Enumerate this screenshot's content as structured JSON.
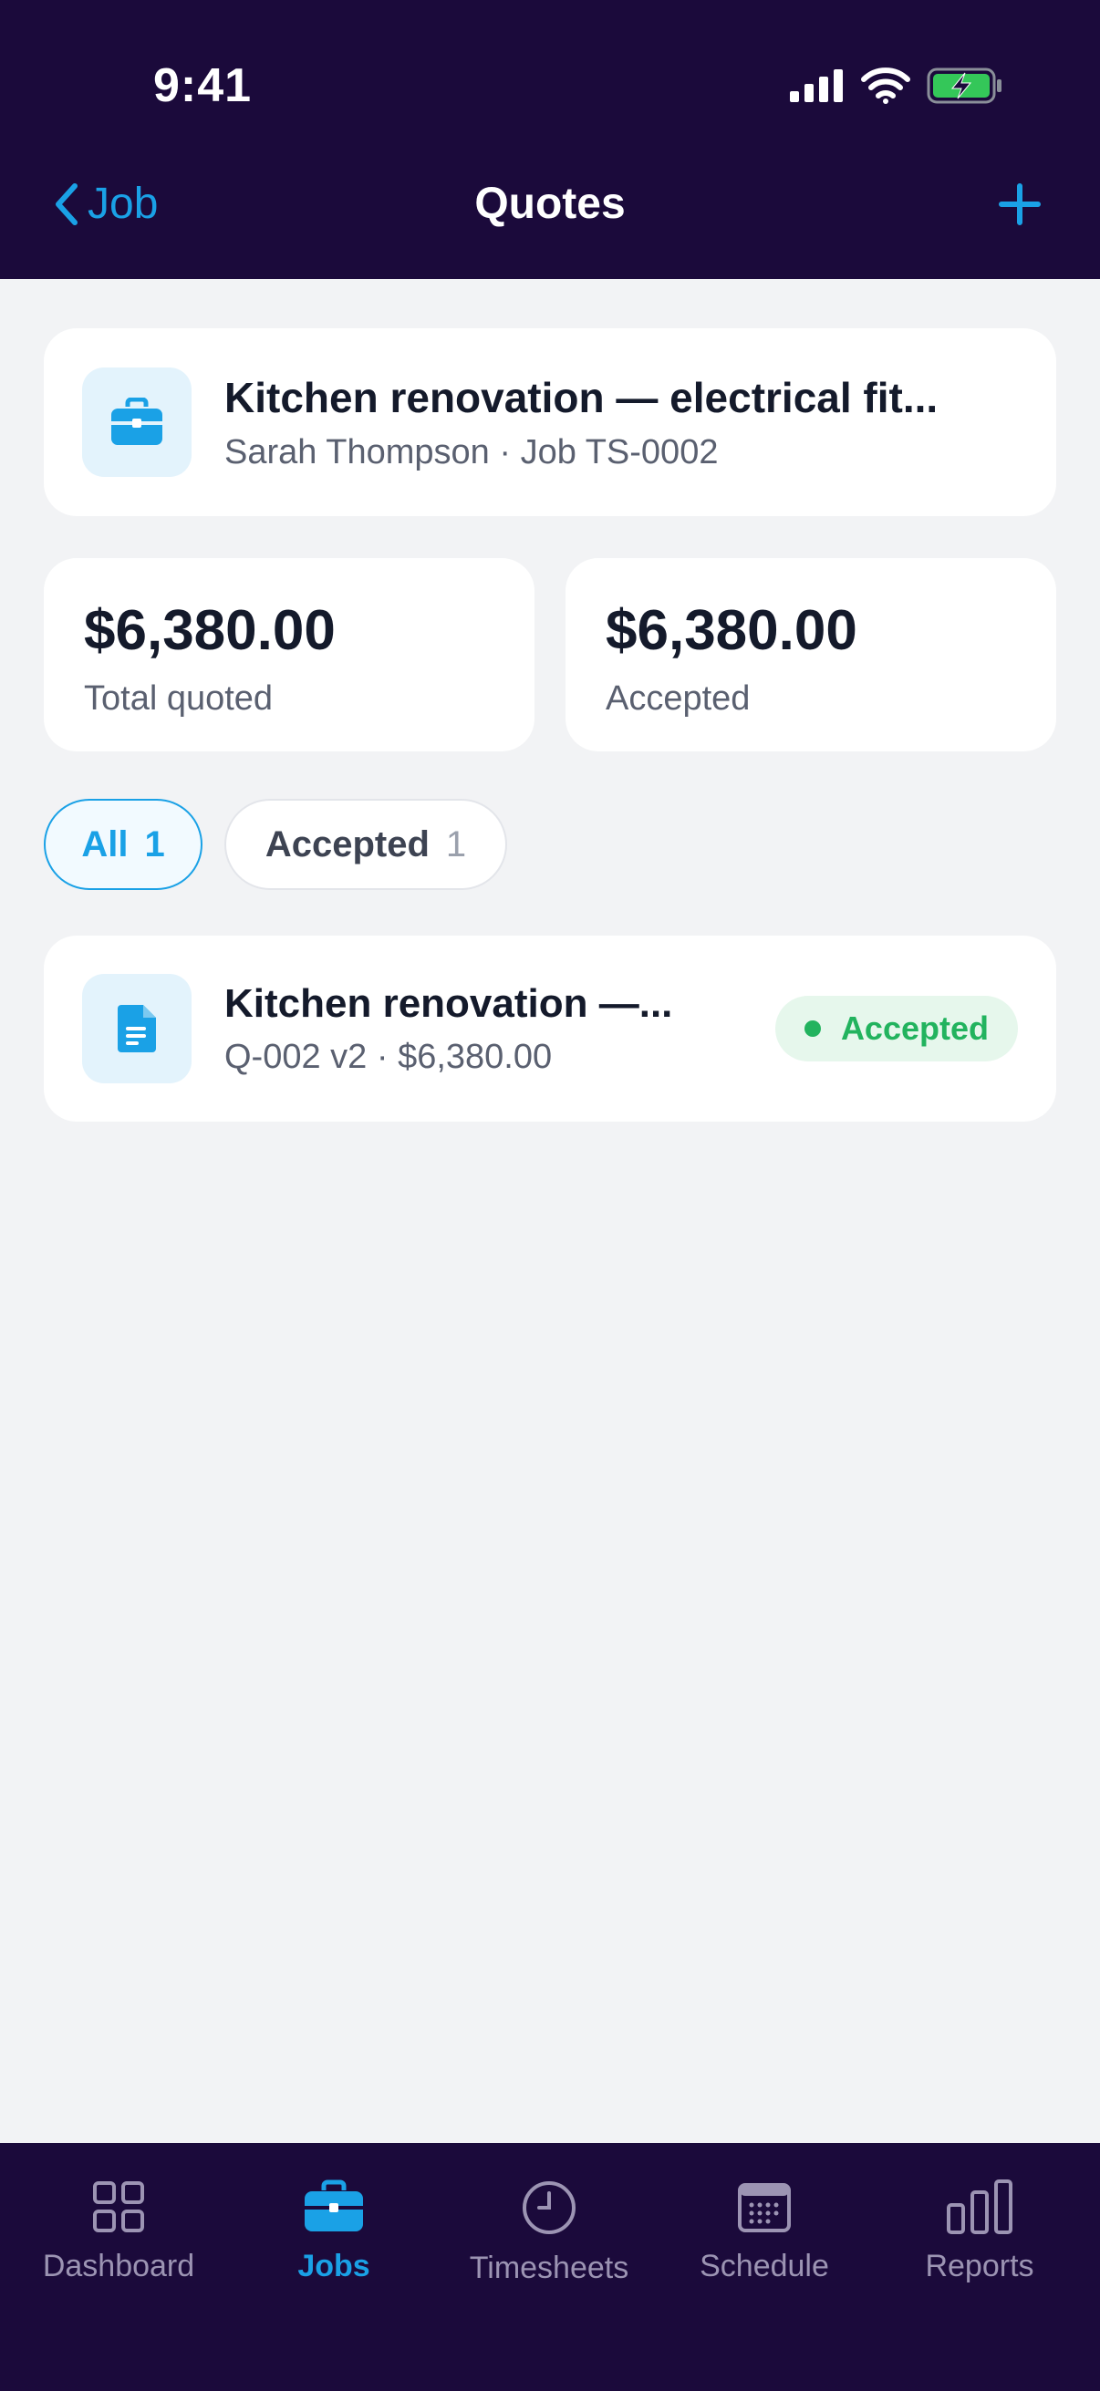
{
  "status_bar": {
    "time": "9:41"
  },
  "nav": {
    "back_label": "Job",
    "title": "Quotes"
  },
  "job": {
    "title": "Kitchen renovation — electrical fit...",
    "subtitle": "Sarah Thompson · Job TS-0002"
  },
  "totals": {
    "quoted_value": "$6,380.00",
    "quoted_label": "Total quoted",
    "accepted_value": "$6,380.00",
    "accepted_label": "Accepted"
  },
  "filters": [
    {
      "label": "All",
      "count": "1",
      "selected": true
    },
    {
      "label": "Accepted",
      "count": "1",
      "selected": false
    }
  ],
  "quotes": [
    {
      "title": "Kitchen renovation —...",
      "meta": "Q-002 v2 · $6,380.00",
      "status": "Accepted"
    }
  ],
  "tabs": [
    {
      "label": "Dashboard",
      "icon": "grid-icon"
    },
    {
      "label": "Jobs",
      "icon": "briefcase-icon",
      "active": true
    },
    {
      "label": "Timesheets",
      "icon": "clock-icon"
    },
    {
      "label": "Schedule",
      "icon": "calendar-icon"
    },
    {
      "label": "Reports",
      "icon": "bar-chart-icon"
    }
  ],
  "colors": {
    "header_bg": "#1b0a3b",
    "accent": "#1aa1e6",
    "success": "#22b35e",
    "page_bg": "#f2f3f5"
  }
}
